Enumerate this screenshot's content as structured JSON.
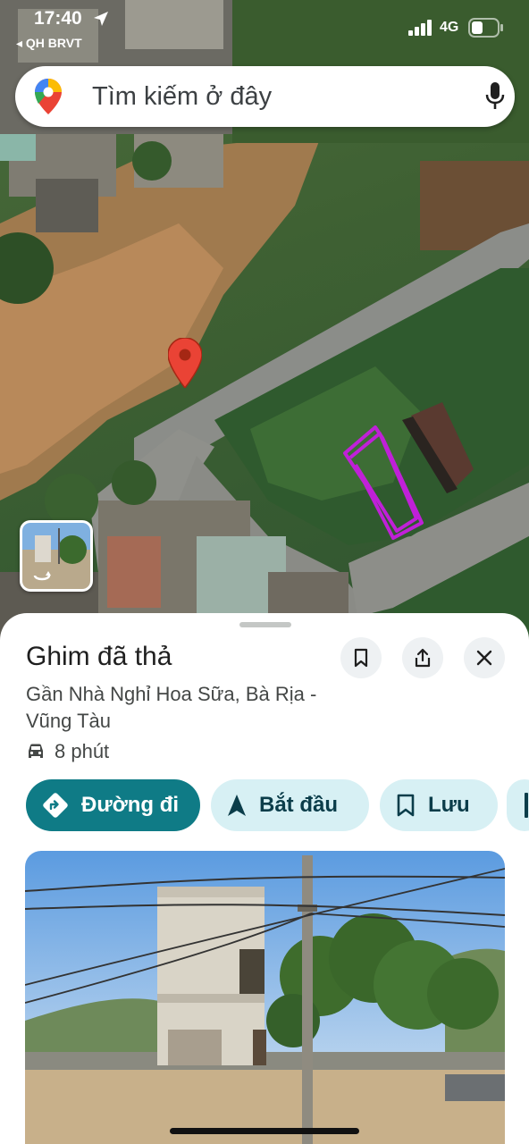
{
  "status_bar": {
    "time": "17:40",
    "back_label": "◂ QH BRVT",
    "network": "4G"
  },
  "search": {
    "placeholder": "Tìm kiếm ở đây"
  },
  "place": {
    "title": "Ghim đã thả",
    "address": "Gần Nhà Nghỉ Hoa Sữa, Bà Rịa - Vũng Tàu",
    "travel_time": "8 phút"
  },
  "actions": {
    "directions": "Đường đi",
    "start": "Bắt đầu",
    "save": "Lưu"
  },
  "colors": {
    "accent_primary": "#0f7b86",
    "chip_bg": "#d7f0f4",
    "pin_red": "#ea4335",
    "highlight_purple": "#c020d8"
  },
  "icons": {
    "pin": "map-pin-icon",
    "mic": "microphone-icon",
    "bookmark": "bookmark-icon",
    "share": "share-icon",
    "close": "close-icon",
    "car": "car-icon",
    "directions": "directions-icon",
    "navigate": "navigation-arrow-icon",
    "street_view": "street-view-icon"
  }
}
